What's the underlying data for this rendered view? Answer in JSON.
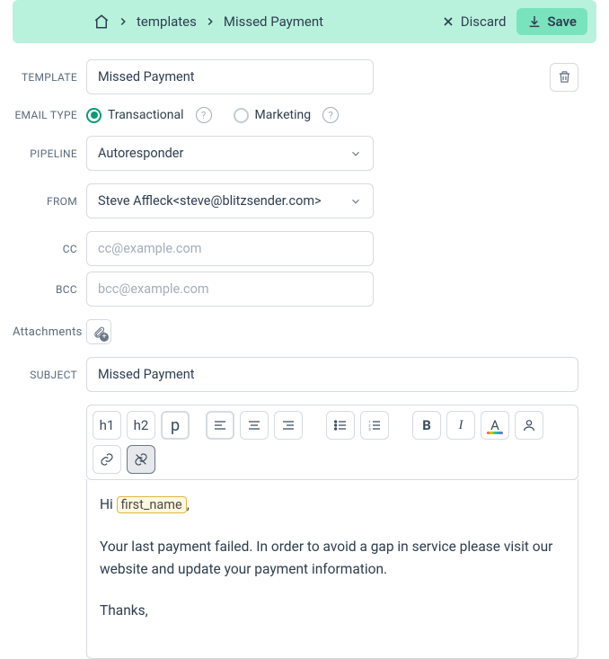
{
  "topbar": {
    "discard_label": "Discard",
    "save_label": "Save"
  },
  "breadcrumb": {
    "templates_label": "templates",
    "current": "Missed Payment"
  },
  "labels": {
    "template": "TEMPLATE",
    "email_type": "EMAIL TYPE",
    "pipeline": "PIPELINE",
    "from": "FROM",
    "cc": "CC",
    "bcc": "BCC",
    "attachments": "Attachments",
    "subject": "SUBJECT"
  },
  "fields": {
    "template_value": "Missed Payment",
    "pipeline_value": "Autoresponder",
    "from_value": "Steve Affleck<steve@blitzsender.com>",
    "cc_placeholder": "cc@example.com",
    "bcc_placeholder": "bcc@example.com",
    "subject_value": "Missed Payment"
  },
  "email_type": {
    "transactional_label": "Transactional",
    "marketing_label": "Marketing",
    "selected": "transactional"
  },
  "toolbar": {
    "h1": "h1",
    "h2": "h2",
    "p": "p",
    "bold": "B",
    "italic": "I",
    "color": "A"
  },
  "editor": {
    "greeting_prefix": "Hi ",
    "merge_tag": "first_name",
    "greeting_suffix": ",",
    "body": "Your last payment failed.  In order to avoid a gap in service please visit our website and update your payment information.",
    "signoff": "Thanks,"
  }
}
